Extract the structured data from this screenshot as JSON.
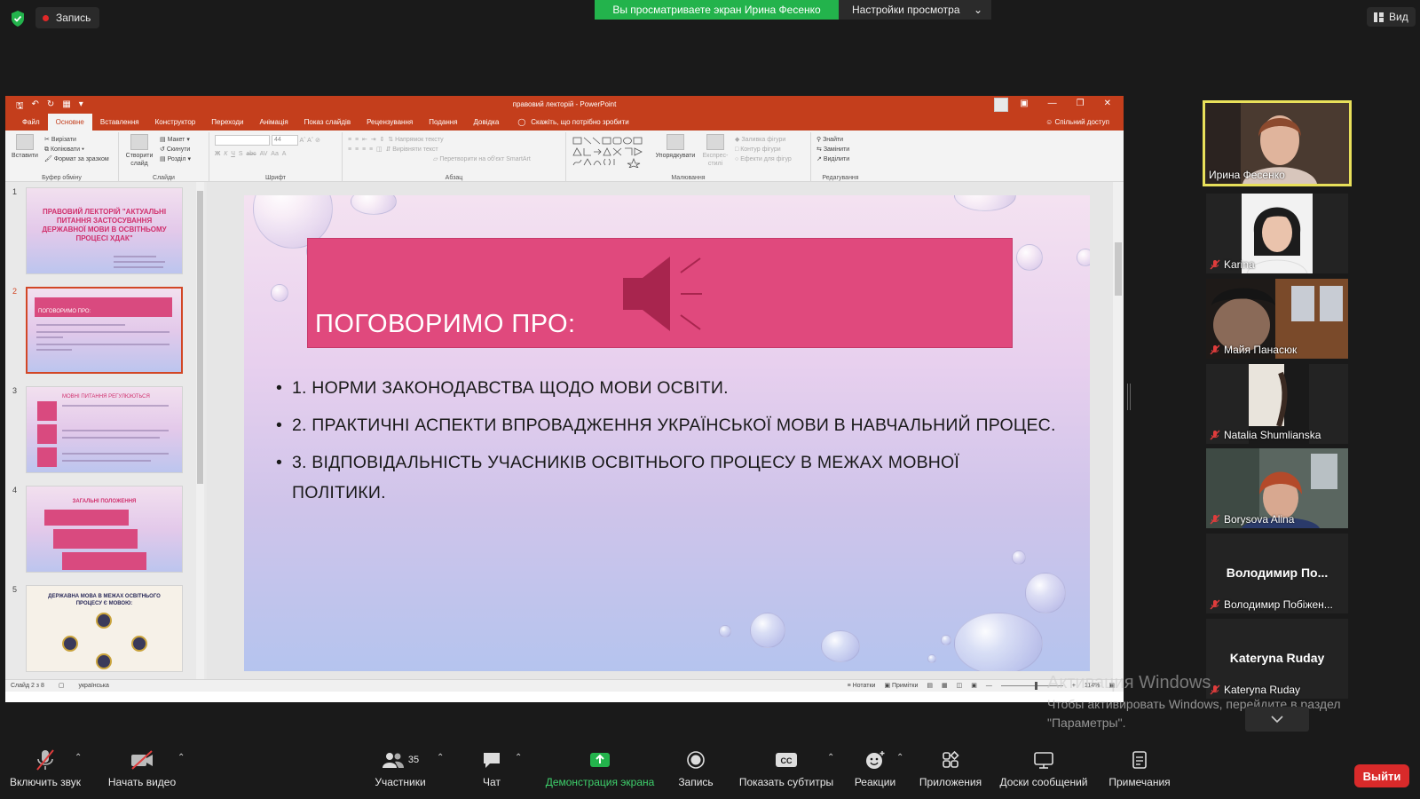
{
  "zoom_top": {
    "record_label": "Запись",
    "viewing_banner": "Вы просматриваете экран Ирина Фесенко",
    "view_settings_label": "Настройки просмотра",
    "view_label": "Вид"
  },
  "ppt": {
    "doc_title": "правовий лекторій  -  PowerPoint",
    "tabs": [
      "Файл",
      "Основне",
      "Вставлення",
      "Конструктор",
      "Переходи",
      "Анімація",
      "Показ слайдів",
      "Рецензування",
      "Подання",
      "Довідка"
    ],
    "active_tab": "Основне",
    "tell_me": "Скажіть, що потрібно зробити",
    "share": "Спільний доступ",
    "ribbon": {
      "clipboard": {
        "name": "Буфер обміну",
        "paste": "Вставити",
        "cut": "Вирізати",
        "copy": "Копіювати",
        "format_painter": "Формат за зразком"
      },
      "slides": {
        "name": "Слайди",
        "new_slide": "Створити слайд",
        "layout": "Макет",
        "reset": "Скинути",
        "section": "Розділ"
      },
      "font": {
        "name": "Шрифт",
        "size": "44"
      },
      "paragraph": {
        "name": "Абзац",
        "text_direction": "Напрямок тексту",
        "align_text": "Вирівняти текст",
        "convert_smartart": "Перетворити на об'єкт SmartArt"
      },
      "drawing": {
        "name": "Малювання",
        "arrange": "Упорядкувати",
        "quick_styles": "Експрес-стилі",
        "fill": "Заливка фігури",
        "outline": "Контур фігури",
        "effects": "Ефекти для фігур"
      },
      "editing": {
        "name": "Редагування",
        "find": "Знайти",
        "replace": "Замінити",
        "select": "Виділити"
      }
    },
    "thumbnails": [
      {
        "num": "1",
        "title": "ПРАВОВИЙ ЛЕКТОРІЙ \"АКТУАЛЬНІ ПИТАННЯ ЗАСТОСУВАННЯ ДЕРЖАВНОЇ МОВИ В ОСВІТНЬОМУ ПРОЦЕСІ ХДАК\""
      },
      {
        "num": "2",
        "title": "ПОГОВОРИМО ПРО:"
      },
      {
        "num": "3",
        "title": "МОВНІ ПИТАННЯ РЕГУЛЮЮТЬСЯ"
      },
      {
        "num": "4",
        "title": "ЗАГАЛЬНІ ПОЛОЖЕННЯ"
      },
      {
        "num": "5",
        "title": "ДЕРЖАВНА МОВА В МЕЖАХ ОСВІТНЬОГО ПРОЦЕСУ Є МОВОЮ:"
      }
    ],
    "selected_slide": 2,
    "slide": {
      "title": "ПОГОВОРИМО ПРО:",
      "bullets": [
        "1. НОРМИ ЗАКОНОДАВСТВА ЩОДО МОВИ ОСВІТИ.",
        "2. ПРАКТИЧНІ АСПЕКТИ ВПРОВАДЖЕННЯ УКРАЇНСЬКОЇ  МОВИ В НАВЧАЛЬНИЙ ПРОЦЕС.",
        "3. ВІДПОВІДАЛЬНІСТЬ УЧАСНИКІВ ОСВІТНЬОГО ПРОЦЕСУ В МЕЖАХ МОВНОЇ ПОЛІТИКИ."
      ]
    },
    "status": {
      "slide_count": "Слайд 2 з 8",
      "language": "українська",
      "notes": "Нотатки",
      "comments": "Примітки",
      "zoom": "114%"
    }
  },
  "participants": [
    {
      "name": "Ирина Фесенко",
      "video": true,
      "muted": false,
      "active": true
    },
    {
      "name": "Karina",
      "video": true,
      "muted": true
    },
    {
      "name": "Майя Панасюк",
      "video": true,
      "muted": true
    },
    {
      "name": "Natalia Shumlianska",
      "video": true,
      "muted": true
    },
    {
      "name": "Borysova Alina",
      "video": true,
      "muted": true
    },
    {
      "name": "Володимир Побіжен...",
      "display": "Володимир  По...",
      "video": false,
      "muted": true
    },
    {
      "name": "Kateryna Ruday",
      "display": "Kateryna Ruday",
      "video": false,
      "muted": true
    }
  ],
  "windows_activation": {
    "line1": "Активация Windows",
    "line2": "Чтобы активировать Windows, перейдите в раздел",
    "line3": "\"Параметры\"."
  },
  "zoom_toolbar": {
    "mute": "Включить звук",
    "video": "Начать видео",
    "participants": "Участники",
    "participants_count": "35",
    "chat": "Чат",
    "share": "Демонстрация экрана",
    "record": "Запись",
    "captions": "Показать субтитры",
    "reactions": "Реакции",
    "apps": "Приложения",
    "whiteboards": "Доски сообщений",
    "notes": "Примечания",
    "leave": "Выйти"
  },
  "colors": {
    "ppt_accent": "#c43e1c",
    "slide_title_fill": "#e0497d",
    "zoom_green": "#23b34c",
    "leave_red": "#d92a2a"
  }
}
